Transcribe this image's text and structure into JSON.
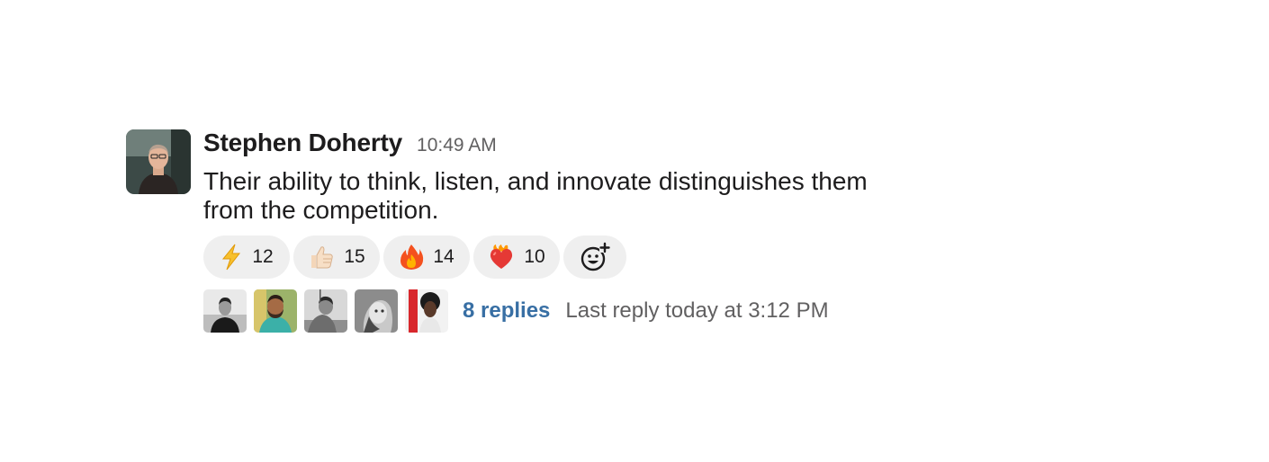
{
  "message": {
    "author": "Stephen Doherty",
    "time": "10:49 AM",
    "text": "Their ability to think, listen, and innovate distinguishes them from the competition."
  },
  "reactions": [
    {
      "emoji": "lightning-bolt-icon",
      "count": "12"
    },
    {
      "emoji": "thumbs-up-icon",
      "count": "15"
    },
    {
      "emoji": "fire-icon",
      "count": "14"
    },
    {
      "emoji": "heart-on-fire-icon",
      "count": "10"
    }
  ],
  "thread": {
    "replies_label": "8 replies",
    "last_reply_label": "Last reply today at 3:12 PM"
  },
  "colors": {
    "link": "#386fa4",
    "muted": "#616061",
    "pill": "#efefef"
  }
}
